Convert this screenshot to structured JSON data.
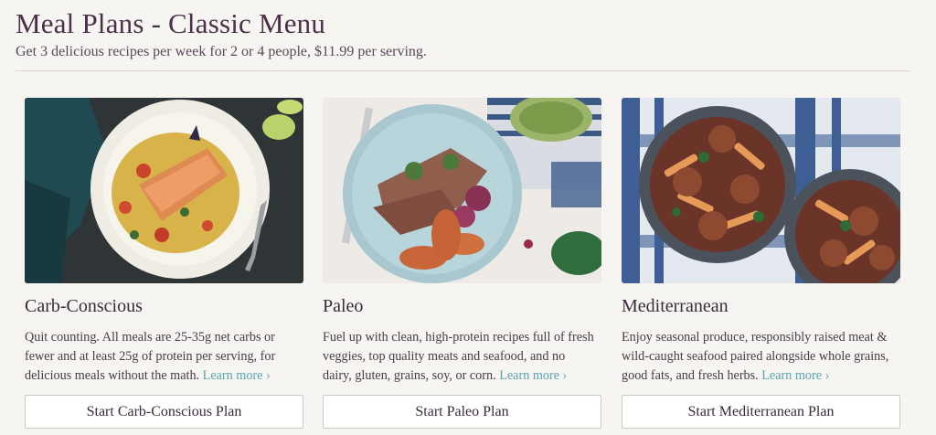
{
  "header": {
    "title": "Meal Plans - Classic Menu",
    "subtitle": "Get 3 delicious recipes per week for 2 or 4 people, $11.99 per serving."
  },
  "plans": [
    {
      "title": "Carb-Conscious",
      "description": "Quit counting. All meals are 25-35g net carbs or fewer and at least 25g of protein per serving, for delicious meals without the math.",
      "learn_more": "Learn more ›",
      "button": "Start Carb-Conscious Plan"
    },
    {
      "title": "Paleo",
      "description": "Fuel up with clean, high-protein recipes full of fresh veggies, top quality meats and seafood, and no dairy, gluten, grains, soy, or corn.",
      "learn_more": "Learn more ›",
      "button": "Start Paleo Plan"
    },
    {
      "title": "Mediterranean",
      "description": "Enjoy seasonal produce, responsibly raised meat & wild-caught seafood paired alongside whole grains, good fats, and fresh herbs.",
      "learn_more": "Learn more ›",
      "button": "Start Mediterranean Plan"
    }
  ],
  "colors": {
    "background": "#f7f5f2",
    "title": "#4b3148",
    "link": "#5aa3b0",
    "button_border": "#cfc8c2"
  }
}
